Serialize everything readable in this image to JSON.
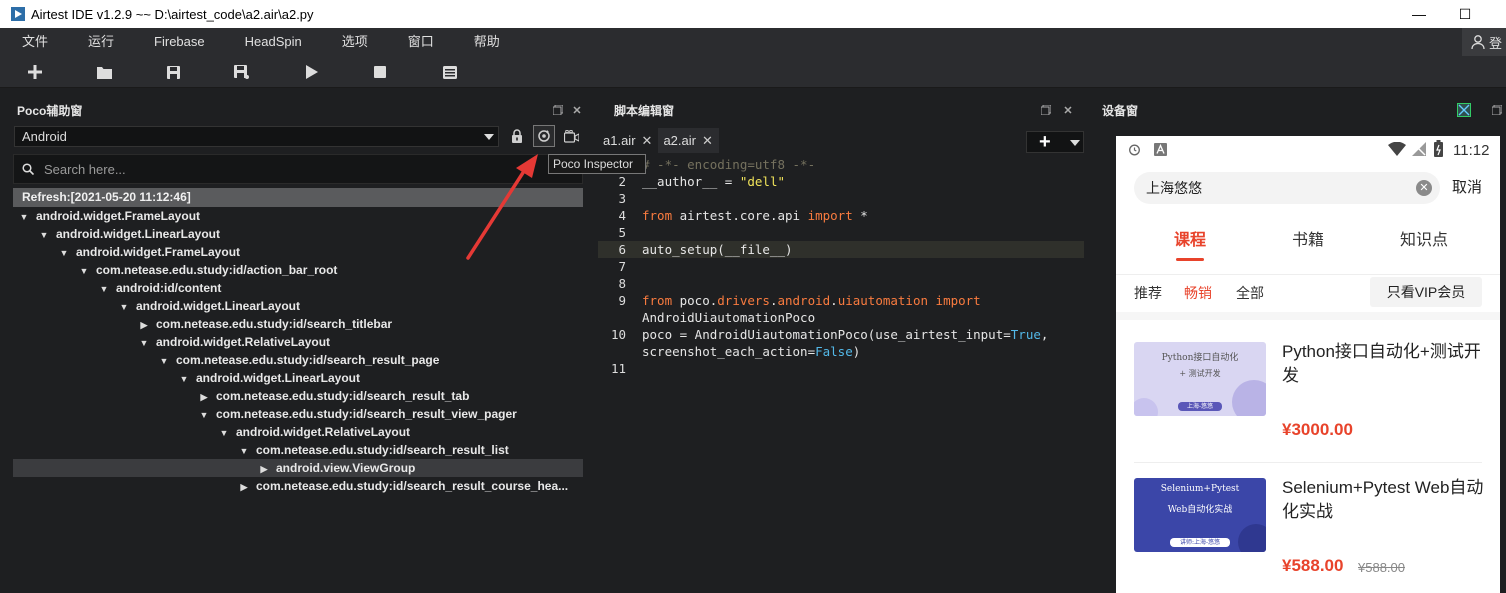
{
  "window": {
    "title": "Airtest IDE v1.2.9 ~~ D:\\airtest_code\\a2.air\\a2.py",
    "minimize_glyph": "—",
    "maximize_glyph": "☐"
  },
  "menu": {
    "items": [
      "文件",
      "运行",
      "Firebase",
      "HeadSpin",
      "选项",
      "窗口",
      "帮助"
    ],
    "user_label": "登"
  },
  "toolbar": {
    "buttons": [
      "plus-icon",
      "folder-icon",
      "save-icon",
      "save-as-icon",
      "run-icon",
      "stop-icon",
      "log-icon"
    ]
  },
  "poco": {
    "title": "Poco辅助窗",
    "platform": "Android",
    "search_placeholder": "Search here...",
    "tooltip": "Poco Inspector",
    "refresh_label": "Refresh:[2021-05-20 11:12:46]",
    "tree": [
      {
        "level": 0,
        "toggle": "▼",
        "label": "android.widget.FrameLayout"
      },
      {
        "level": 1,
        "toggle": "▼",
        "label": "android.widget.LinearLayout"
      },
      {
        "level": 2,
        "toggle": "▼",
        "label": "android.widget.FrameLayout"
      },
      {
        "level": 3,
        "toggle": "▼",
        "label": "com.netease.edu.study:id/action_bar_root"
      },
      {
        "level": 4,
        "toggle": "▼",
        "label": "android:id/content"
      },
      {
        "level": 5,
        "toggle": "▼",
        "label": "android.widget.LinearLayout"
      },
      {
        "level": 6,
        "toggle": "▶",
        "label": "com.netease.edu.study:id/search_titlebar"
      },
      {
        "level": 6,
        "toggle": "▼",
        "label": "android.widget.RelativeLayout"
      },
      {
        "level": 7,
        "toggle": "▼",
        "label": "com.netease.edu.study:id/search_result_page"
      },
      {
        "level": 8,
        "toggle": "▼",
        "label": "android.widget.LinearLayout"
      },
      {
        "level": 9,
        "toggle": "▶",
        "label": "com.netease.edu.study:id/search_result_tab"
      },
      {
        "level": 9,
        "toggle": "▼",
        "label": "com.netease.edu.study:id/search_result_view_pager"
      },
      {
        "level": 10,
        "toggle": "▼",
        "label": "android.widget.RelativeLayout"
      },
      {
        "level": 11,
        "toggle": "▼",
        "label": "com.netease.edu.study:id/search_result_list"
      },
      {
        "level": 12,
        "toggle": "▶",
        "label": "android.view.ViewGroup",
        "selected": true
      },
      {
        "level": 11,
        "toggle": "▶",
        "label": "com.netease.edu.study:id/search_result_course_hea..."
      }
    ]
  },
  "editor": {
    "title": "脚本编辑窗",
    "tabs": [
      {
        "label": "a1.air",
        "active": false
      },
      {
        "label": "a2.air",
        "active": true
      }
    ],
    "lines": [
      {
        "n": "1",
        "html": "<span class=\"cm\"># -*- encoding=utf8 -*-</span>"
      },
      {
        "n": "2",
        "html": "__author__ = <span class=\"str\">\"dell\"</span>"
      },
      {
        "n": "3",
        "html": ""
      },
      {
        "n": "4",
        "html": "<span class=\"kw\">from</span> airtest.core.api <span class=\"kw\">import</span> *"
      },
      {
        "n": "5",
        "html": ""
      },
      {
        "n": "6",
        "html": "auto_setup(__file__)",
        "current": true
      },
      {
        "n": "7",
        "html": ""
      },
      {
        "n": "8",
        "html": ""
      },
      {
        "n": "9",
        "html": "<span class=\"kw\">from</span> poco.<span class=\"mod\">drivers</span>.<span class=\"mod\">android</span>.<span class=\"mod\">uiautomation</span> <span class=\"kw\">import</span>"
      },
      {
        "n": "",
        "html": "AndroidUiautomationPoco"
      },
      {
        "n": "10",
        "html": "poco = AndroidUiautomationPoco(use_airtest_input=<span class=\"tr\">True</span>,"
      },
      {
        "n": "",
        "html": "screenshot_each_action=<span class=\"tr\">False</span>)"
      },
      {
        "n": "11",
        "html": ""
      }
    ]
  },
  "device": {
    "title": "设备窗",
    "status_time": "11:12",
    "search_value": "上海悠悠",
    "cancel": "取消",
    "tabs": [
      "课程",
      "书籍",
      "知识点"
    ],
    "filters": [
      "推荐",
      "畅销",
      "全部"
    ],
    "vip_button": "只看VIP会员",
    "courses": [
      {
        "title": "Python接口自动化+测试开发",
        "price": "¥3000.00",
        "old_price": "",
        "thumb_line1": "Python接口自动化",
        "thumb_line2": "+ 测试开发",
        "thumb_tag": "上海-悠悠",
        "thumb_bg": "#d9d6f2"
      },
      {
        "title": "Selenium+Pytest Web自动化实战",
        "price": "¥588.00",
        "old_price": "¥588.00",
        "thumb_line1": "Selenium+Pytest",
        "thumb_line2": "Web自动化实战",
        "thumb_tag": "讲师:上海-悠悠",
        "thumb_bg": "#3b46a8"
      }
    ]
  },
  "colors": {
    "accent_red": "#e8432b",
    "arrow_red": "#e53935"
  }
}
